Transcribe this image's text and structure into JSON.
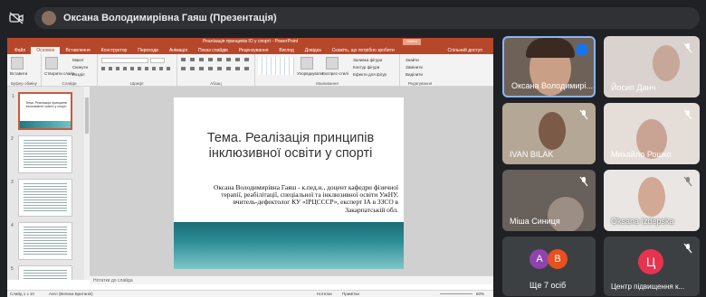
{
  "meeting": {
    "presenter_title": "Оксана Володимирівна Гаяш (Презентація)"
  },
  "ppt": {
    "window_title": "Реалізація принципів ІО у спорті  -  PowerPoint",
    "signin": "Увійти",
    "tabs": [
      "Файл",
      "Основне",
      "Вставлення",
      "Конструктор",
      "Переходи",
      "Анімація",
      "Показ слайдів",
      "Рецензування",
      "Вигляд",
      "Довідка",
      "Скажіть, що потрібно зробити"
    ],
    "share": "Спільний доступ",
    "ribbon": {
      "clipboard": "Буфер обміну",
      "paste": "Вставити",
      "slides": "Слайди",
      "new_slide": "Створити слайд",
      "layout": "Макет",
      "reset": "Скинути",
      "section": "Розділ",
      "font": "Шрифт",
      "paragraph": "Абзац",
      "drawing": "Малювання",
      "arrange": "Упорядкувати",
      "quick_styles": "Експрес-стилі",
      "fill": "Заливка фігури",
      "outline": "Контур фігури",
      "effects": "Ефекти для фігур",
      "find": "Знайти",
      "replace": "Замінити",
      "select": "Виділити",
      "editing": "Редагування"
    },
    "thumbs": [
      {
        "num": "1",
        "text": "Тема. Реалізація принципів інклюзивної освіти у спорті"
      },
      {
        "num": "2",
        "text": ""
      },
      {
        "num": "3",
        "text": ""
      },
      {
        "num": "4",
        "text": ""
      },
      {
        "num": "5",
        "text": ""
      }
    ],
    "slide": {
      "title": "Тема. Реалізація принципів інклюзивної освіти у спорті",
      "body": "Оксана Володимирівна Гаяш - к.пед.н., доцент кафедри фізичної терапії, реабілітації, спеціальної та інклюзивної освіти УжНУ, вчитель-дефектолог КУ «ІРЦСССР», експерт ІА в ЗЗСО в Закарпатській обл."
    },
    "notes": "Нотатки до слайда",
    "status": {
      "slide": "Слайд 1 з 10",
      "lang": "Англ (Велика Британія)",
      "notes_btn": "Нотатки",
      "comments_btn": "Примітки",
      "zoom": "60%"
    }
  },
  "participants": [
    {
      "name": "Оксана Володимирі...",
      "speaking": true
    },
    {
      "name": "Йосип Данч"
    },
    {
      "name": "IVAN BILAK"
    },
    {
      "name": "Михайло Рошко"
    },
    {
      "name": "Міша Синиця"
    },
    {
      "name": "Oksana Izdepska"
    },
    {
      "name": "Ще 7 осіб",
      "avatars": [
        "A",
        "B"
      ]
    },
    {
      "name": "Центр підвищення к...",
      "avatar": "Ц"
    }
  ],
  "colors": {
    "ppt_accent": "#b7472a",
    "bg": "#202124",
    "tile": "#3c4043",
    "av_a": "#8e44ad",
    "av_b": "#e8501f",
    "av_c": "#e8334f"
  }
}
